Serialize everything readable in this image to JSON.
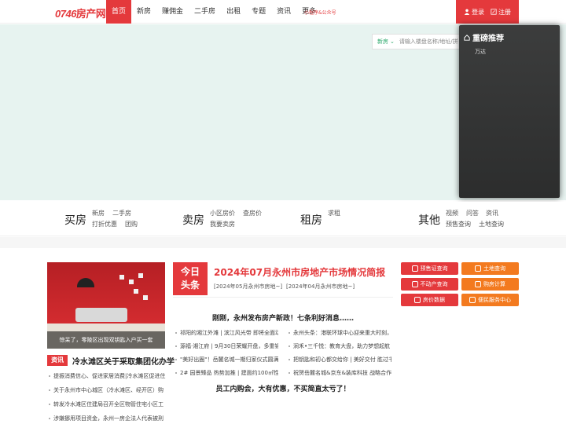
{
  "header": {
    "logo_num": "0746",
    "logo_text": "房产网",
    "nav": [
      {
        "label": "首页",
        "active": true
      },
      {
        "label": "新房"
      },
      {
        "label": "赚佣金"
      },
      {
        "label": "二手房"
      },
      {
        "label": "出租"
      },
      {
        "label": "专题"
      },
      {
        "label": "资讯"
      },
      {
        "label": "更多"
      }
    ],
    "mini_link": "小程序&公众号",
    "login": "登录",
    "register": "注册",
    "accent": "#e4393c"
  },
  "search": {
    "type": "新房",
    "placeholder": "请输入楼盘名称/地址/拼"
  },
  "overlay": {
    "title": "重磅推荐",
    "items": [
      "万达"
    ]
  },
  "categories": [
    {
      "title": "买房",
      "links": [
        "新房",
        "二手房",
        "打折优惠",
        "团购"
      ]
    },
    {
      "title": "卖房",
      "links": [
        "小区房价",
        "查房价",
        "我要卖房"
      ]
    },
    {
      "title": "租房",
      "links": [
        "求租"
      ]
    },
    {
      "title": "其他",
      "links": [
        "视频",
        "问答",
        "资讯",
        "预售查询",
        "土地查询"
      ]
    }
  ],
  "feature": {
    "caption": "惊呆了，零陵区出现双钥匙入户买一套",
    "tag": "资讯",
    "headline": "冷水滩区关于采取集团化办学",
    "list": [
      "提振消费信心、促进家居消费|冷水滩区促进住",
      "关于永州市中心城区（冷水滩区、经开区）购",
      "转发冷水滩区住建局召开全区物管住宅小区工",
      "涉嫌挪用项目资金，永州一房企法人代表被刑"
    ]
  },
  "today": {
    "badge_line1": "今日",
    "badge_line2": "头条",
    "title": "2024年07月永州市房地产市场情况简报",
    "sub1": "[2024年05月永州市房地~]",
    "sub2": "[2024年04月永州市房地~]",
    "headline1": "刚刚，永州发布房产新政！七条利好消息……",
    "headline2": "员工内购会，大有优惠，不买简直太亏了！",
    "left_items": [
      "祁阳的湘江外滩 | 滨江风光带 即将全面动",
      "源福·湘江府 | 9月30日荣耀开盘，多重钜",
      "\"美好出圈\"！岳麓名城一期归家仪式圆满",
      "2# 园景臻品 热势加推 | 建面约100㎡性价"
    ],
    "right_items": [
      "永州头条：港联环球中心迎来重大时刻，",
      "涧禾•三千悦：教育大盘，助力梦想起航",
      "把钥匙和初心都交给你 | 美好交付 胜过千",
      "祝贺岳麓名城&京东&装库科技 战略合作"
    ]
  },
  "services": [
    {
      "label": "预售证查询",
      "color": "red"
    },
    {
      "label": "土地查询",
      "color": "orange"
    },
    {
      "label": "不动产查询",
      "color": "red"
    },
    {
      "label": "购房计算",
      "color": "orange"
    },
    {
      "label": "房价数据",
      "color": "red"
    },
    {
      "label": "便民服务中心",
      "color": "orange"
    }
  ]
}
